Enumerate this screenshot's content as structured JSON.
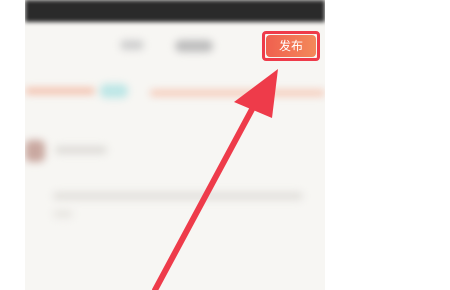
{
  "header": {
    "publish_label": "发布"
  },
  "annotation": {
    "arrow_color": "#ee3b4a"
  },
  "colors": {
    "accent": "#f0604f",
    "accent_end": "#f3895a",
    "highlight_border": "#ee3b4a"
  }
}
